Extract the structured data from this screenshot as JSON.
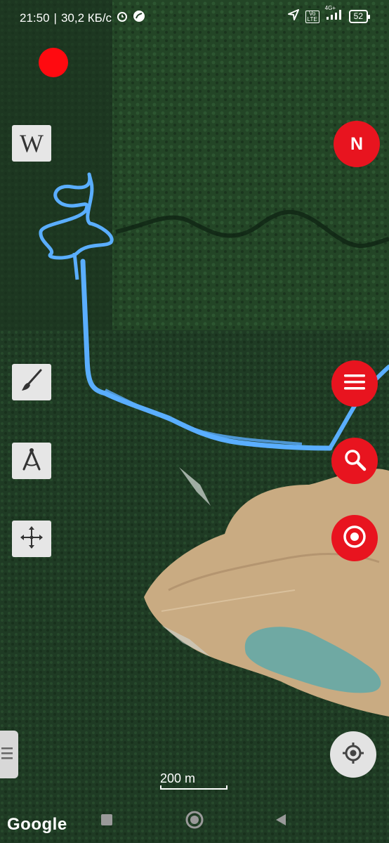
{
  "status_bar": {
    "time": "21:50",
    "speed": "30,2 КБ/с",
    "network": "4G+",
    "volte": "Vo LTE",
    "battery": "52"
  },
  "map": {
    "scale_label": "200 m",
    "attribution": "Google"
  },
  "icons": {
    "wikipedia": "wikipedia-icon",
    "brush": "brush-icon",
    "compass": "compass-icon",
    "move": "move-icon",
    "north": "north-icon",
    "menu": "menu-icon",
    "search": "search-icon",
    "target": "target-icon",
    "locate": "my-location-icon"
  },
  "buttons": {
    "wiki_label": "W",
    "north_label": "N"
  },
  "colors": {
    "accent": "#e8141f",
    "track": "#5aaeff",
    "tool_bg": "#e6e6e6"
  }
}
